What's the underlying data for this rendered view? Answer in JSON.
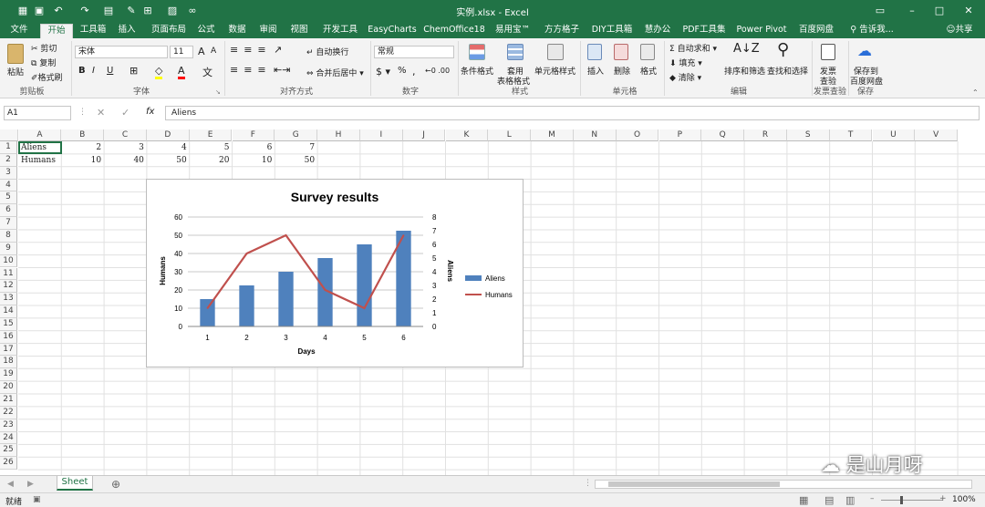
{
  "window": {
    "title": "实例.xlsx - Excel"
  },
  "qat_icons": [
    "save-icon",
    "undo-icon",
    "redo-icon",
    "paste-icon",
    "brush-icon",
    "table-icon",
    "image-icon",
    "link-icon"
  ],
  "tabs": [
    "文件",
    "开始",
    "工具箱",
    "插入",
    "页面布局",
    "公式",
    "数据",
    "审阅",
    "视图",
    "开发工具",
    "EasyCharts",
    "ChemOffice18",
    "易用宝™",
    "方方格子",
    "DIY工具箱",
    "慧办公",
    "PDF工具集",
    "Power Pivot",
    "百度网盘"
  ],
  "active_tab": "开始",
  "tell_me": "告诉我...",
  "share": "共享",
  "ribbon": {
    "clipboard": {
      "paste": "粘贴",
      "cut": "剪切",
      "copy": "复制",
      "format_painter": "格式刷",
      "group": "剪贴板"
    },
    "font": {
      "name": "宋体",
      "size": "11",
      "bold": "B",
      "italic": "I",
      "underline": "U",
      "grow": "A",
      "shrink": "A",
      "group": "字体"
    },
    "alignment": {
      "wrap": "自动换行",
      "merge": "合并后居中",
      "group": "对齐方式"
    },
    "number": {
      "format": "常规",
      "percent": "%",
      "group": "数字"
    },
    "styles": {
      "conditional": "条件格式",
      "table_l1": "套用",
      "table_l2": "表格格式",
      "cell_style": "单元格样式",
      "group": "样式"
    },
    "cells": {
      "insert": "插入",
      "delete": "删除",
      "format": "格式",
      "group": "单元格"
    },
    "editing": {
      "autosum": "自动求和",
      "fill": "填充",
      "clear": "清除",
      "sort": "排序和筛选",
      "find": "查找和选择",
      "group": "编辑"
    },
    "invoice": {
      "l1": "发票",
      "l2": "查验",
      "group": "发票查验"
    },
    "save": {
      "l1": "保存到",
      "l2": "百度网盘",
      "group": "保存"
    }
  },
  "formula_bar": {
    "namebox": "A1",
    "fx": "fx",
    "value": "Aliens"
  },
  "columns": [
    "A",
    "B",
    "C",
    "D",
    "E",
    "F",
    "G",
    "H",
    "I",
    "J",
    "K",
    "L",
    "M",
    "N",
    "O",
    "P",
    "Q",
    "R",
    "S",
    "T",
    "U",
    "V"
  ],
  "rows": [
    "1",
    "2",
    "3",
    "4",
    "5",
    "6",
    "7",
    "8",
    "9",
    "10",
    "11",
    "12",
    "13",
    "14",
    "15",
    "16",
    "17",
    "18",
    "19",
    "20",
    "21",
    "22",
    "23",
    "24",
    "25",
    "26"
  ],
  "cells": {
    "row1": {
      "label": "Aliens",
      "values": [
        "2",
        "3",
        "4",
        "5",
        "6",
        "7"
      ]
    },
    "row2": {
      "label": "Humans",
      "values": [
        "10",
        "40",
        "50",
        "20",
        "10",
        "50"
      ]
    }
  },
  "chart_data": {
    "type": "bar",
    "title": "Survey results",
    "categories": [
      "1",
      "2",
      "3",
      "4",
      "5",
      "6"
    ],
    "xlabel": "Days",
    "ylabel": "Humans",
    "y2label": "Aliens",
    "ylim": [
      0,
      60
    ],
    "y2lim": [
      0,
      8
    ],
    "yticks": [
      "0",
      "10",
      "20",
      "30",
      "40",
      "50",
      "60"
    ],
    "y2ticks": [
      "0",
      "1",
      "2",
      "3",
      "4",
      "5",
      "6",
      "7",
      "8"
    ],
    "series": [
      {
        "name": "Aliens",
        "type": "bar",
        "axis": "secondary",
        "values": [
          2,
          3,
          4,
          5,
          6,
          7
        ],
        "color": "#4f81bd"
      },
      {
        "name": "Humans",
        "type": "line",
        "axis": "primary",
        "values": [
          10,
          40,
          50,
          20,
          10,
          50
        ],
        "color": "#c0504d"
      }
    ],
    "grid": true,
    "legend": "right"
  },
  "sheet_tab": "Sheet",
  "status": {
    "ready": "就绪",
    "zoom": "100%"
  },
  "watermark": "是山月呀",
  "colors": {
    "accent": "#217346",
    "bar": "#4f81bd",
    "line": "#c0504d"
  }
}
